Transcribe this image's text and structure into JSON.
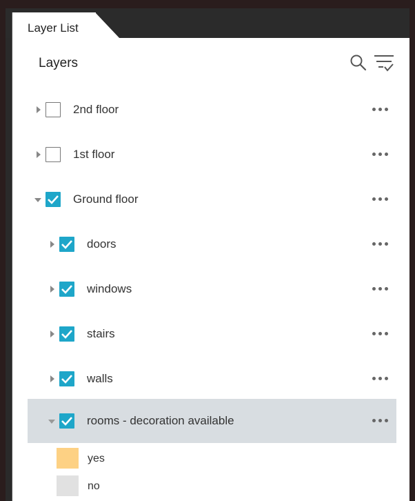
{
  "tab": {
    "label": "Layer List"
  },
  "panel": {
    "title": "Layers"
  },
  "layers": [
    {
      "label": "2nd floor",
      "checked": false,
      "expanded": false
    },
    {
      "label": "1st floor",
      "checked": false,
      "expanded": false
    },
    {
      "label": "Ground floor",
      "checked": true,
      "expanded": true
    },
    {
      "label": "doors",
      "checked": true,
      "expanded": false
    },
    {
      "label": "windows",
      "checked": true,
      "expanded": false
    },
    {
      "label": "stairs",
      "checked": true,
      "expanded": false
    },
    {
      "label": "walls",
      "checked": true,
      "expanded": false
    },
    {
      "label": "rooms - decoration available",
      "checked": true,
      "expanded": true,
      "selected": true
    }
  ],
  "legend": [
    {
      "label": "yes",
      "color": "#fdd184"
    },
    {
      "label": "no",
      "color": "#e1e1e1"
    }
  ],
  "colors": {
    "accent": "#1ea6c9",
    "selected_row": "#d8dde1",
    "frame": "#2a1d1d"
  },
  "icons": {
    "search": "search-icon",
    "filter": "filter-list-icon",
    "options": "ellipsis-icon"
  }
}
